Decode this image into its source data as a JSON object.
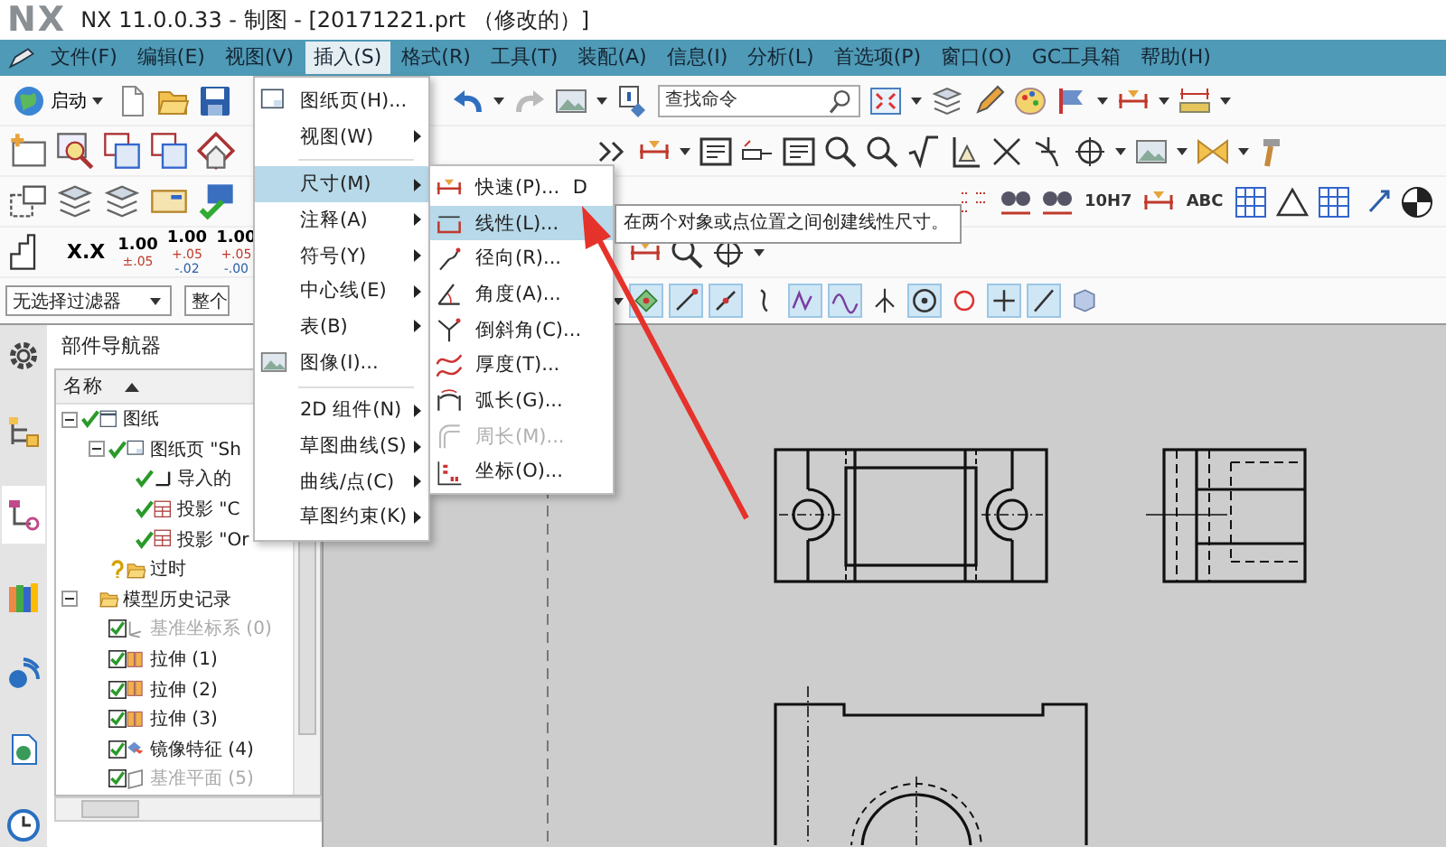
{
  "window": {
    "logo": "NX",
    "title": "NX 11.0.0.33 - 制图 - [20171221.prt （修改的）]"
  },
  "menu_bar": [
    {
      "label": "文件(F)",
      "selected": false
    },
    {
      "label": "编辑(E)",
      "selected": false
    },
    {
      "label": "视图(V)",
      "selected": false
    },
    {
      "label": "插入(S)",
      "selected": true
    },
    {
      "label": "格式(R)",
      "selected": false
    },
    {
      "label": "工具(T)",
      "selected": false
    },
    {
      "label": "装配(A)",
      "selected": false
    },
    {
      "label": "信息(I)",
      "selected": false
    },
    {
      "label": "分析(L)",
      "selected": false
    },
    {
      "label": "首选项(P)",
      "selected": false
    },
    {
      "label": "窗口(O)",
      "selected": false
    },
    {
      "label": "GC工具箱",
      "selected": false
    },
    {
      "label": "帮助(H)",
      "selected": false
    }
  ],
  "toolbar": {
    "start_button": "启动",
    "command_search": {
      "placeholder": "查找命令"
    },
    "decimal_button": "X.X",
    "tolerance_buttons": [
      {
        "value": "1.00",
        "upper": "±.05"
      },
      {
        "value": "1.00",
        "upper": "+.05",
        "lower": "-.02"
      },
      {
        "value": "1.00",
        "upper": "+.05",
        "lower": "-.00"
      }
    ],
    "fit_button": "10H7",
    "text_button": "ABC"
  },
  "selection_bar": {
    "type_filter": "无选择过滤器",
    "scope_filter": "整个",
    "snap_buttons": [
      {
        "kind": "points",
        "on": true
      },
      {
        "kind": "end",
        "on": true
      },
      {
        "kind": "mid",
        "on": true
      },
      {
        "kind": "control",
        "on": false
      },
      {
        "kind": "intersect",
        "on": true
      },
      {
        "kind": "spline",
        "on": true
      },
      {
        "kind": "fork",
        "on": false
      },
      {
        "kind": "center",
        "on": true
      },
      {
        "kind": "quadrant",
        "on": false
      },
      {
        "kind": "point",
        "on": true
      },
      {
        "kind": "online",
        "on": true
      },
      {
        "kind": "body",
        "on": false
      }
    ]
  },
  "resource_bar": {
    "tabs": [
      {
        "kind": "settings",
        "selected": false
      },
      {
        "kind": "assembly",
        "selected": false
      },
      {
        "kind": "part",
        "selected": true
      },
      {
        "kind": "library",
        "selected": false
      },
      {
        "kind": "info",
        "selected": false
      },
      {
        "kind": "web",
        "selected": false
      },
      {
        "kind": "history",
        "selected": false
      }
    ]
  },
  "part_navigator": {
    "title": "部件导航器",
    "column": "名称",
    "tree": [
      {
        "label": "图纸",
        "kind": "drawing",
        "checked": true,
        "expanded": true,
        "children": [
          {
            "label": "图纸页 \"Sh",
            "kind": "sheet",
            "checked": true,
            "expanded": true,
            "children": [
              {
                "label": "导入的",
                "kind": "imported",
                "checked": true
              },
              {
                "label": "投影 \"C",
                "kind": "projection",
                "checked": true
              },
              {
                "label": "投影 \"Or",
                "kind": "projection",
                "checked": true
              }
            ]
          },
          {
            "label": "过时",
            "kind": "folder",
            "checked": false
          }
        ]
      },
      {
        "label": "模型历史记录",
        "kind": "folder",
        "expanded": true,
        "children": [
          {
            "label": "基准坐标系 (0)",
            "kind": "coordsys",
            "checkbox": true,
            "checked": true,
            "dimmed": true
          },
          {
            "label": "拉伸 (1)",
            "kind": "extrude",
            "checkbox": true,
            "checked": true,
            "dimmed": false
          },
          {
            "label": "拉伸 (2)",
            "kind": "extrude",
            "checkbox": true,
            "checked": true,
            "dimmed": false
          },
          {
            "label": "拉伸 (3)",
            "kind": "extrude",
            "checkbox": true,
            "checked": true,
            "dimmed": false
          },
          {
            "label": "镜像特征 (4)",
            "kind": "mirror",
            "checkbox": true,
            "checked": true,
            "dimmed": false
          },
          {
            "label": "基准平面 (5)",
            "kind": "plane",
            "checkbox": true,
            "checked": true,
            "dimmed": true
          }
        ]
      }
    ]
  },
  "insert_menu": {
    "items": [
      {
        "kind": "sheet",
        "label": "图纸页(H)...",
        "submenu": false,
        "selected": false
      },
      {
        "kind": "plain",
        "label": "视图(W)",
        "submenu": true,
        "selected": false
      },
      {
        "kind": "separator"
      },
      {
        "kind": "plain",
        "label": "尺寸(M)",
        "submenu": true,
        "selected": true
      },
      {
        "kind": "plain",
        "label": "注释(A)",
        "submenu": true,
        "selected": false
      },
      {
        "kind": "plain",
        "label": "符号(Y)",
        "submenu": true,
        "selected": false
      },
      {
        "kind": "plain",
        "label": "中心线(E)",
        "submenu": true,
        "selected": false
      },
      {
        "kind": "plain",
        "label": "表(B)",
        "submenu": true,
        "selected": false
      },
      {
        "kind": "image",
        "label": "图像(I)...",
        "submenu": false,
        "selected": false
      },
      {
        "kind": "separator"
      },
      {
        "kind": "plain",
        "label": "2D 组件(N)",
        "submenu": true,
        "selected": false
      },
      {
        "kind": "plain",
        "label": "草图曲线(S)",
        "submenu": true,
        "selected": false
      },
      {
        "kind": "plain",
        "label": "曲线/点(C)",
        "submenu": true,
        "selected": false
      },
      {
        "kind": "plain",
        "label": "草图约束(K)",
        "submenu": true,
        "selected": false
      }
    ]
  },
  "dimension_submenu": {
    "items": [
      {
        "label": "快速(P)...",
        "shortcut": "D",
        "kind": "rapid",
        "selected": false,
        "disabled": false
      },
      {
        "label": "线性(L)...",
        "kind": "linear",
        "selected": true,
        "disabled": false
      },
      {
        "label": "径向(R)...",
        "kind": "radial",
        "selected": false,
        "disabled": false
      },
      {
        "label": "角度(A)...",
        "kind": "angular",
        "selected": false,
        "disabled": false
      },
      {
        "label": "倒斜角(C)...",
        "kind": "chamfer",
        "selected": false,
        "disabled": false
      },
      {
        "label": "厚度(T)...",
        "kind": "thickness",
        "selected": false,
        "disabled": false
      },
      {
        "label": "弧长(G)...",
        "kind": "arc",
        "selected": false,
        "disabled": false
      },
      {
        "label": "周长(M)...",
        "kind": "perimeter",
        "selected": false,
        "disabled": true
      },
      {
        "label": "坐标(O)...",
        "kind": "ordinate",
        "selected": false,
        "disabled": false
      }
    ]
  },
  "tooltip": "在两个对象或点位置之间创建线性尺寸。"
}
